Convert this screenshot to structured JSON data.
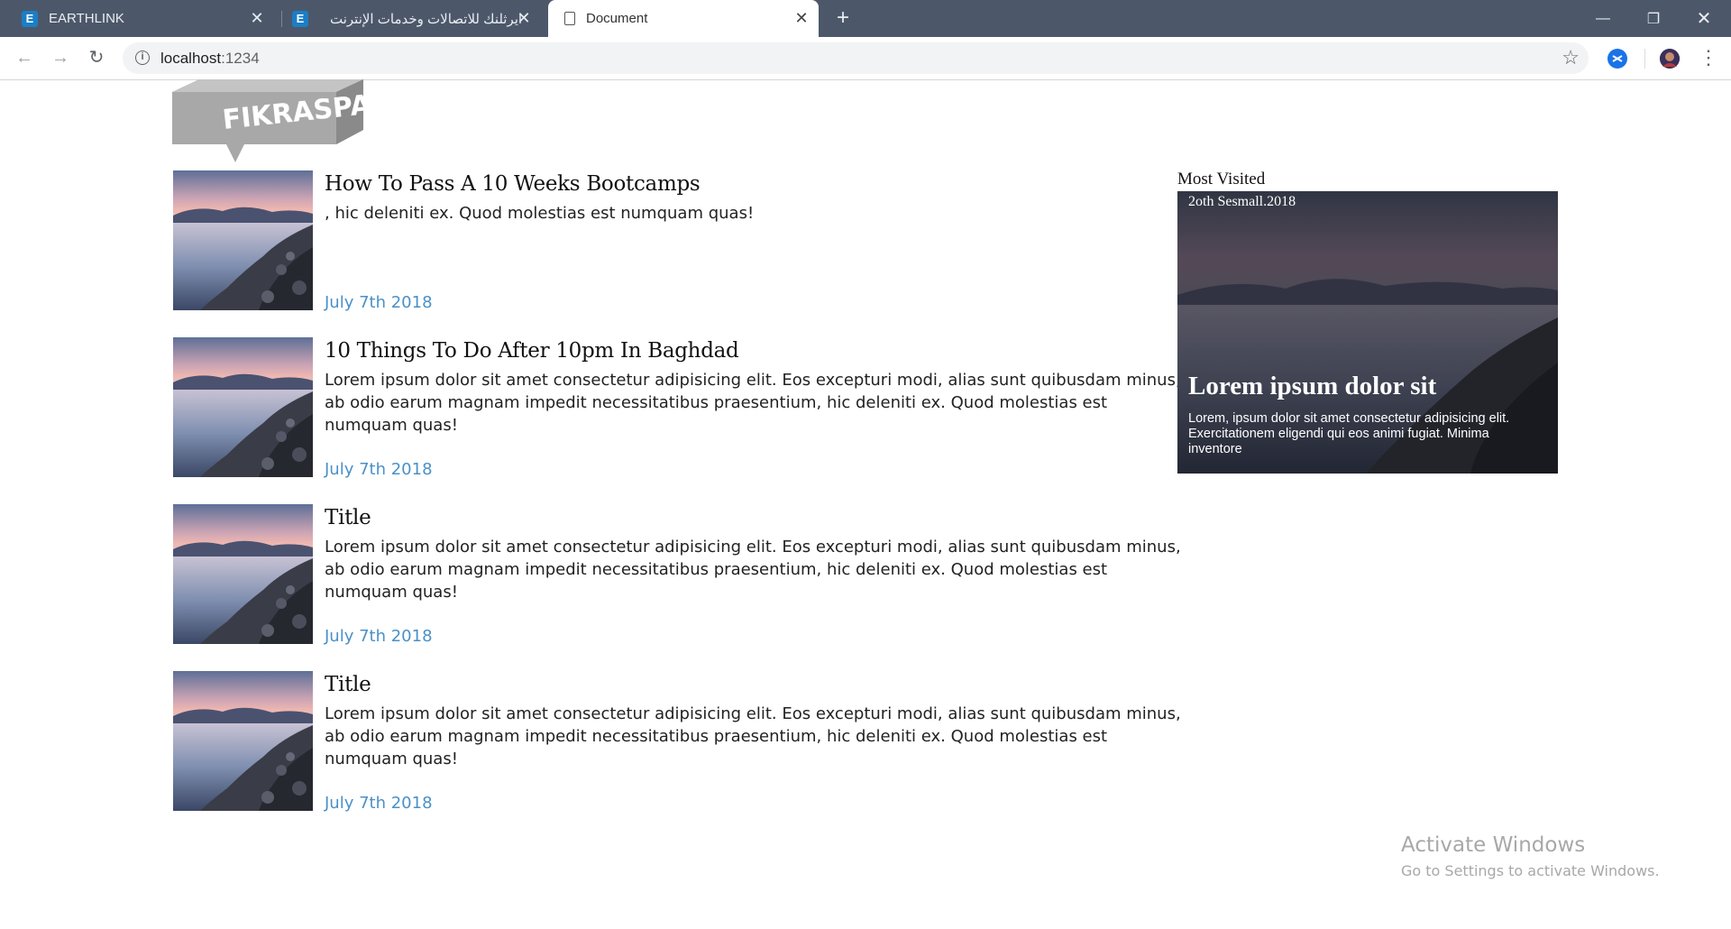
{
  "browser": {
    "tabs": [
      {
        "label": "EARTHLINK",
        "favicon": "E",
        "active": false
      },
      {
        "label": "ايرثلنك للاتصالات وخدمات الإنترنت",
        "favicon": "E",
        "active": false
      },
      {
        "label": "Document",
        "favicon": "document-icon",
        "active": true
      }
    ],
    "url_host": "localhost",
    "url_port": ":1234"
  },
  "page": {
    "logo_text": "FIKRASPACE",
    "posts": [
      {
        "title": "How To Pass A 10 Weeks Bootcamps",
        "excerpt": ", hic deleniti ex. Quod molestias est numquam quas!",
        "date": "July 7th 2018"
      },
      {
        "title": "10 Things To Do After 10pm In Baghdad",
        "excerpt": "Lorem ipsum dolor sit amet consectetur adipisicing elit. Eos excepturi modi, alias sunt quibusdam minus, ab odio earum magnam impedit necessitatibus praesentium, hic deleniti ex. Quod molestias est numquam quas!",
        "date": "July 7th 2018"
      },
      {
        "title": "Title",
        "excerpt": "Lorem ipsum dolor sit amet consectetur adipisicing elit. Eos excepturi modi, alias sunt quibusdam minus, ab odio earum magnam impedit necessitatibus praesentium, hic deleniti ex. Quod molestias est numquam quas!",
        "date": "July 7th 2018"
      },
      {
        "title": "Title",
        "excerpt": "Lorem ipsum dolor sit amet consectetur adipisicing elit. Eos excepturi modi, alias sunt quibusdam minus, ab odio earum magnam impedit necessitatibus praesentium, hic deleniti ex. Quod molestias est numquam quas!",
        "date": "July 7th 2018"
      }
    ],
    "sidebar": {
      "heading": "Most Visited",
      "feature": {
        "date": "2oth Sesmall.2018",
        "title": "Lorem ipsum dolor sit",
        "description": "Lorem, ipsum dolor sit amet consectetur adipisicing elit. Exercitationem eligendi qui eos animi fugiat. Minima inventore"
      }
    }
  },
  "watermark": {
    "line1": "Activate Windows",
    "line2": "Go to Settings to activate Windows."
  },
  "colors": {
    "tabbar": "#4c586a",
    "date_link": "#4a90c8"
  }
}
